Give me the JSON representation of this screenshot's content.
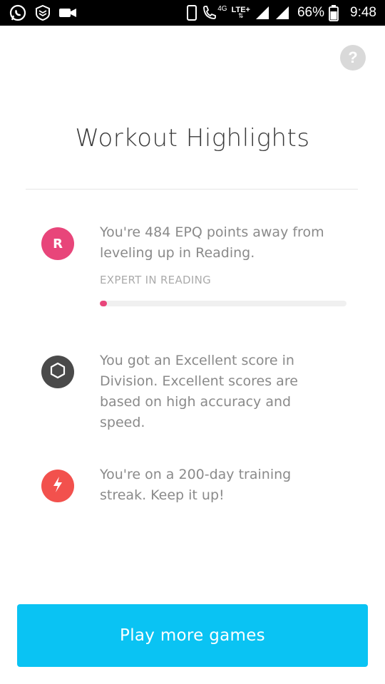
{
  "status_bar": {
    "network_label": "4G",
    "lte_label": "LTE+",
    "battery_percent": "66%",
    "time": "9:48",
    "icons": [
      "whatsapp-icon",
      "shield-app-icon",
      "video-camera-icon",
      "phone-device-icon",
      "wifi-call-icon",
      "signal-icon",
      "signal-icon",
      "battery-icon"
    ]
  },
  "header": {
    "help_label": "?"
  },
  "title": "Workout Highlights",
  "highlights": [
    {
      "icon_letter": "R",
      "icon_color": "#e8457a",
      "text": "You're 484 EPQ points away from leveling up in Reading.",
      "sublabel": "EXPERT IN READING",
      "progress": 0.03
    },
    {
      "icon": "hexagon-icon",
      "icon_color": "#4a4a4a",
      "text": "You got an Excellent score in Division. Excellent scores are based on high accuracy and speed."
    },
    {
      "icon": "lightning-bolt-icon",
      "icon_color": "#f2514d",
      "text": "You're on a 200-day training streak. Keep it up!"
    }
  ],
  "cta": {
    "label": "Play more games",
    "color": "#0ac3f3"
  }
}
